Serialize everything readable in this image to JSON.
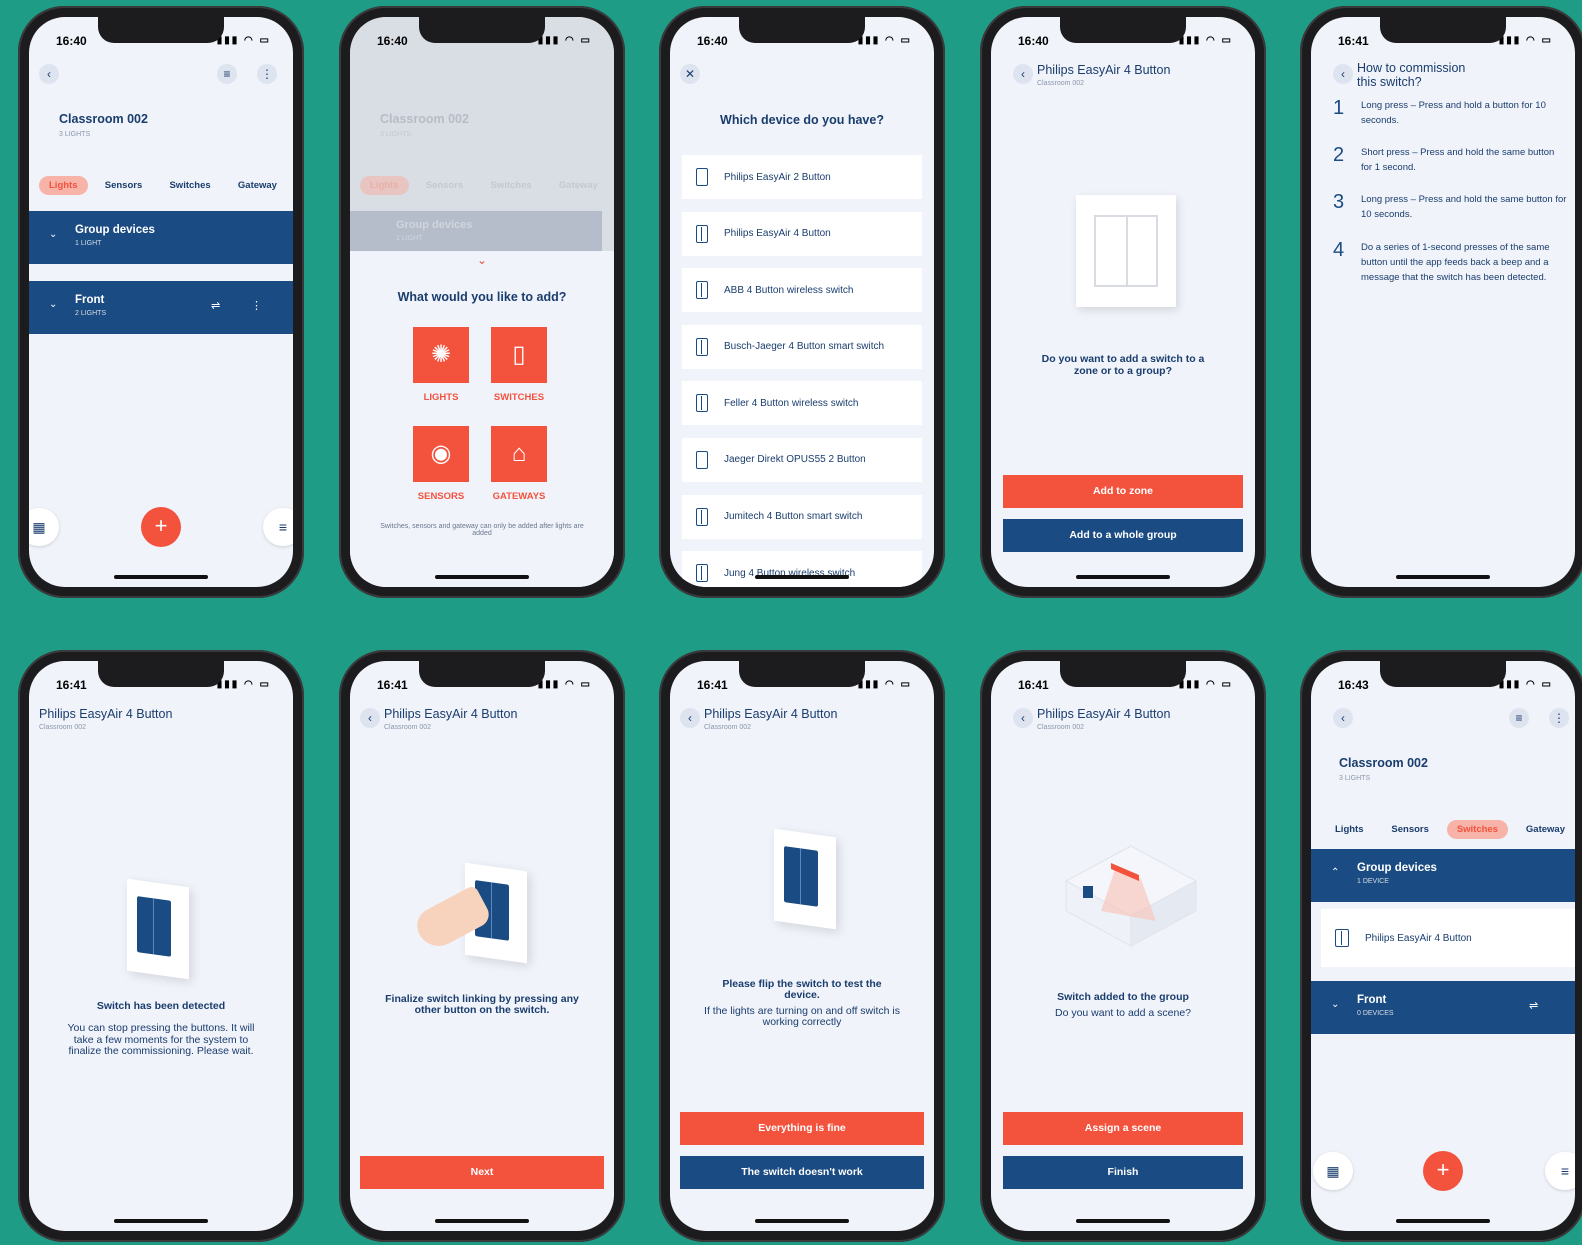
{
  "colors": {
    "background": "#1f9c86",
    "accent": "#f3523d",
    "navy": "#1a4b82"
  },
  "s1": {
    "time": "16:40",
    "title": "Classroom 002",
    "subtitle": "3 LIGHTS",
    "tabs": [
      "Lights",
      "Sensors",
      "Switches",
      "Gateway"
    ],
    "groups": [
      {
        "title": "Group devices",
        "sub": "1 LIGHT"
      },
      {
        "title": "Front",
        "sub": "2 LIGHTS"
      }
    ]
  },
  "s2": {
    "time": "16:40",
    "bg_title": "Classroom 002",
    "bg_sub": "3 LIGHTS",
    "bg_tabs": [
      "Lights",
      "Sensors",
      "Switches",
      "Gateway"
    ],
    "bg_group": "Group devices",
    "bg_group_sub": "1 LIGHT",
    "heading": "What would you like to add?",
    "options": [
      "LIGHTS",
      "SWITCHES",
      "SENSORS",
      "GATEWAYS"
    ],
    "note": "Switches, sensors and gateway can only be added after lights are added"
  },
  "s3": {
    "time": "16:40",
    "heading": "Which device do you have?",
    "devices": [
      "Philips EasyAir 2 Button",
      "Philips EasyAir 4 Button",
      "ABB 4 Button wireless switch",
      "Busch-Jaeger 4 Button smart switch",
      "Feller 4 Button wireless switch",
      "Jaeger Direkt OPUS55 2 Button",
      "Jumitech 4 Button smart switch",
      "Jung 4 Button wireless switch"
    ]
  },
  "s4": {
    "time": "16:40",
    "title": "Philips EasyAir 4 Button",
    "subtitle": "Classroom 002",
    "question": "Do you want to add a switch to a zone or to a group?",
    "btn_zone": "Add to zone",
    "btn_group": "Add to a whole group"
  },
  "s5": {
    "time": "16:41",
    "title": "How to commission this switch?",
    "steps": [
      {
        "n": "1",
        "t": "Long press – Press and hold a button for 10 seconds."
      },
      {
        "n": "2",
        "t": "Short press – Press and hold the same button for 1 second."
      },
      {
        "n": "3",
        "t": "Long press – Press and hold the same button for 10 seconds."
      },
      {
        "n": "4",
        "t": "Do a series of 1-second presses of the same button until the app feeds back a beep and a message that the switch has been detected."
      }
    ]
  },
  "s6": {
    "time": "16:41",
    "title": "Philips EasyAir 4 Button",
    "subtitle": "Classroom 002",
    "heading": "Switch has been detected",
    "body": "You can stop pressing the buttons. It will take a few moments for the system to finalize the commissioning. Please wait."
  },
  "s7": {
    "time": "16:41",
    "title": "Philips EasyAir 4 Button",
    "subtitle": "Classroom 002",
    "heading": "Finalize switch linking by pressing any other button on the switch.",
    "btn": "Next"
  },
  "s8": {
    "time": "16:41",
    "title": "Philips EasyAir 4 Button",
    "subtitle": "Classroom 002",
    "heading": "Please flip the switch to test the device.",
    "body": "If the lights are turning on and off switch is working correctly",
    "btn_ok": "Everything is fine",
    "btn_bad": "The switch doesn't work"
  },
  "s9": {
    "time": "16:41",
    "title": "Philips EasyAir 4 Button",
    "subtitle": "Classroom 002",
    "heading": "Switch added to the group",
    "body": "Do you want to add a scene?",
    "btn_scene": "Assign a scene",
    "btn_finish": "Finish"
  },
  "s10": {
    "time": "16:43",
    "title": "Classroom 002",
    "subtitle": "3 LIGHTS",
    "tabs": [
      "Lights",
      "Sensors",
      "Switches",
      "Gateway"
    ],
    "groups": [
      {
        "title": "Group devices",
        "sub": "1 DEVICE"
      },
      {
        "title": "Front",
        "sub": "0 DEVICES"
      }
    ],
    "device": "Philips EasyAir 4 Button"
  }
}
